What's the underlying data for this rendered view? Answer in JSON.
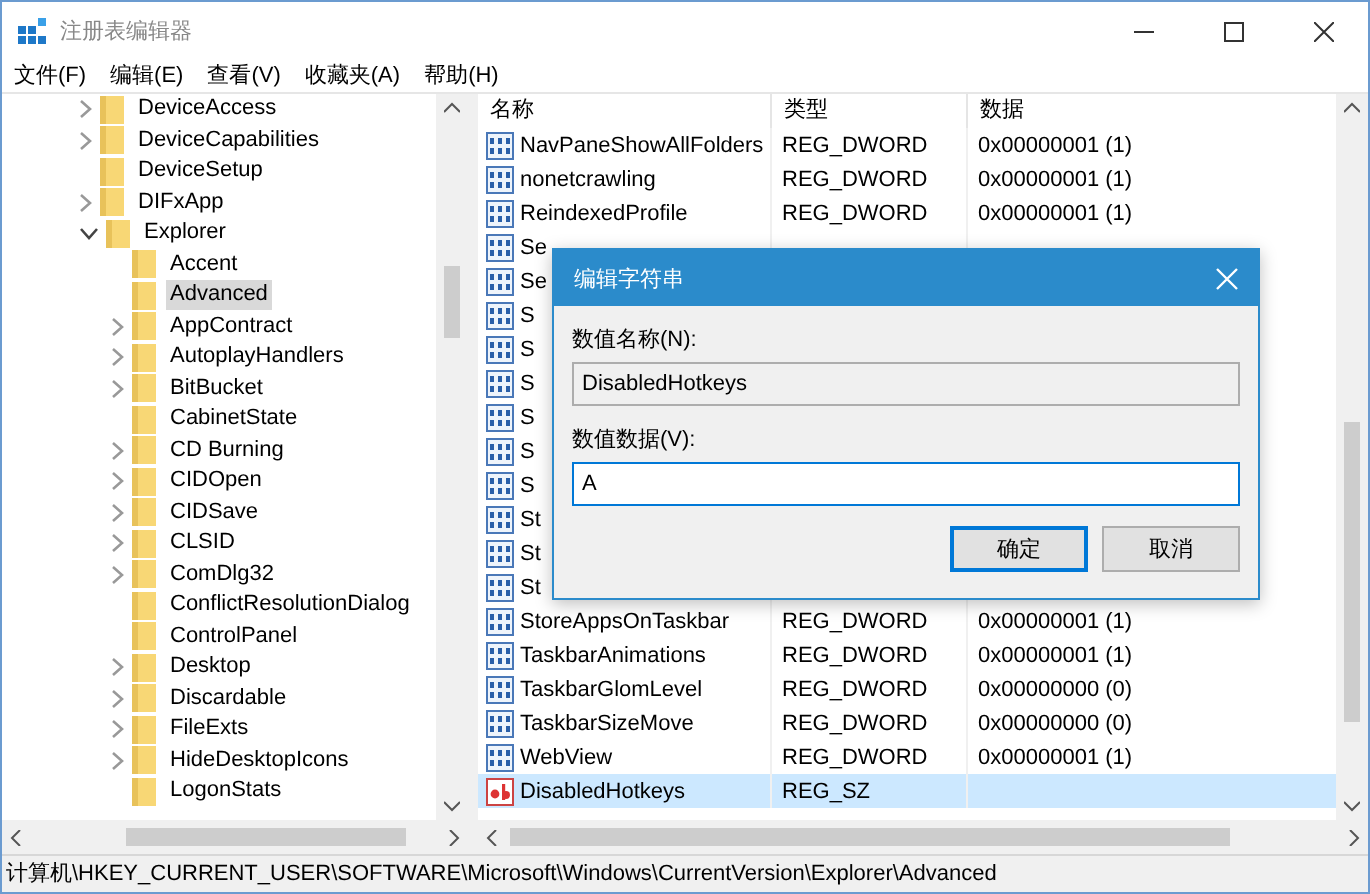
{
  "window": {
    "title": "注册表编辑器"
  },
  "menu": [
    "文件(F)",
    "编辑(E)",
    "查看(V)",
    "收藏夹(A)",
    "帮助(H)"
  ],
  "tree": [
    {
      "label": "DeviceAccess",
      "expanded": false,
      "selected": false
    },
    {
      "label": "DeviceCapabilities",
      "expanded": false,
      "selected": false
    },
    {
      "label": "DeviceSetup",
      "selected": false
    },
    {
      "label": "DIFxApp",
      "expanded": false,
      "selected": false
    },
    {
      "label": "Explorer",
      "expanded": true,
      "selected": false,
      "children": [
        {
          "label": "Accent",
          "selected": false
        },
        {
          "label": "Advanced",
          "selected": true
        },
        {
          "label": "AppContract",
          "expanded": false,
          "selected": false
        },
        {
          "label": "AutoplayHandlers",
          "expanded": false,
          "selected": false
        },
        {
          "label": "BitBucket",
          "expanded": false,
          "selected": false
        },
        {
          "label": "CabinetState",
          "selected": false
        },
        {
          "label": "CD Burning",
          "expanded": false,
          "selected": false
        },
        {
          "label": "CIDOpen",
          "expanded": false,
          "selected": false
        },
        {
          "label": "CIDSave",
          "expanded": false,
          "selected": false
        },
        {
          "label": "CLSID",
          "expanded": false,
          "selected": false
        },
        {
          "label": "ComDlg32",
          "expanded": false,
          "selected": false
        },
        {
          "label": "ConflictResolutionDialog",
          "selected": false
        },
        {
          "label": "ControlPanel",
          "selected": false
        },
        {
          "label": "Desktop",
          "expanded": false,
          "selected": false
        },
        {
          "label": "Discardable",
          "expanded": false,
          "selected": false
        },
        {
          "label": "FileExts",
          "expanded": false,
          "selected": false
        },
        {
          "label": "HideDesktopIcons",
          "expanded": false,
          "selected": false
        },
        {
          "label": "LogonStats",
          "selected": false
        }
      ]
    }
  ],
  "table": {
    "columns": [
      "名称",
      "类型",
      "数据"
    ],
    "rows": [
      {
        "kind": "dword",
        "name": "NavPaneShowAllFolders",
        "type": "REG_DWORD",
        "data": "0x00000001 (1)",
        "selected": false
      },
      {
        "kind": "dword",
        "name": "nonetcrawling",
        "type": "REG_DWORD",
        "data": "0x00000001 (1)",
        "selected": false
      },
      {
        "kind": "dword",
        "name": "ReindexedProfile",
        "type": "REG_DWORD",
        "data": "0x00000001 (1)",
        "selected": false
      },
      {
        "kind": "dword",
        "name": "Se",
        "selected": false
      },
      {
        "kind": "dword",
        "name": "Se",
        "selected": false
      },
      {
        "kind": "dword",
        "name": "S",
        "selected": false
      },
      {
        "kind": "dword",
        "name": "S",
        "selected": false
      },
      {
        "kind": "dword",
        "name": "S",
        "selected": false
      },
      {
        "kind": "dword",
        "name": "S",
        "selected": false
      },
      {
        "kind": "dword",
        "name": "S",
        "selected": false
      },
      {
        "kind": "dword",
        "name": "S",
        "selected": false
      },
      {
        "kind": "dword",
        "name": "St",
        "selected": false
      },
      {
        "kind": "dword",
        "name": "St",
        "selected": false
      },
      {
        "kind": "dword",
        "name": "St",
        "selected": false
      },
      {
        "kind": "dword",
        "name": "StoreAppsOnTaskbar",
        "type": "REG_DWORD",
        "data": "0x00000001 (1)",
        "selected": false
      },
      {
        "kind": "dword",
        "name": "TaskbarAnimations",
        "type": "REG_DWORD",
        "data": "0x00000001 (1)",
        "selected": false
      },
      {
        "kind": "dword",
        "name": "TaskbarGlomLevel",
        "type": "REG_DWORD",
        "data": "0x00000000 (0)",
        "selected": false
      },
      {
        "kind": "dword",
        "name": "TaskbarSizeMove",
        "type": "REG_DWORD",
        "data": "0x00000000 (0)",
        "selected": false
      },
      {
        "kind": "dword",
        "name": "WebView",
        "type": "REG_DWORD",
        "data": "0x00000001 (1)",
        "selected": false
      },
      {
        "kind": "sz",
        "name": "DisabledHotkeys",
        "type": "REG_SZ",
        "selected": true
      }
    ]
  },
  "dialog": {
    "title": "编辑字符串",
    "name_label": "数值名称(N):",
    "name_value": "DisabledHotkeys",
    "data_label": "数值数据(V):",
    "data_value": "A",
    "ok": "确定",
    "cancel": "取消"
  },
  "status_bar": "计算机\\HKEY_CURRENT_USER\\SOFTWARE\\Microsoft\\Windows\\CurrentVersion\\Explorer\\Advanced"
}
